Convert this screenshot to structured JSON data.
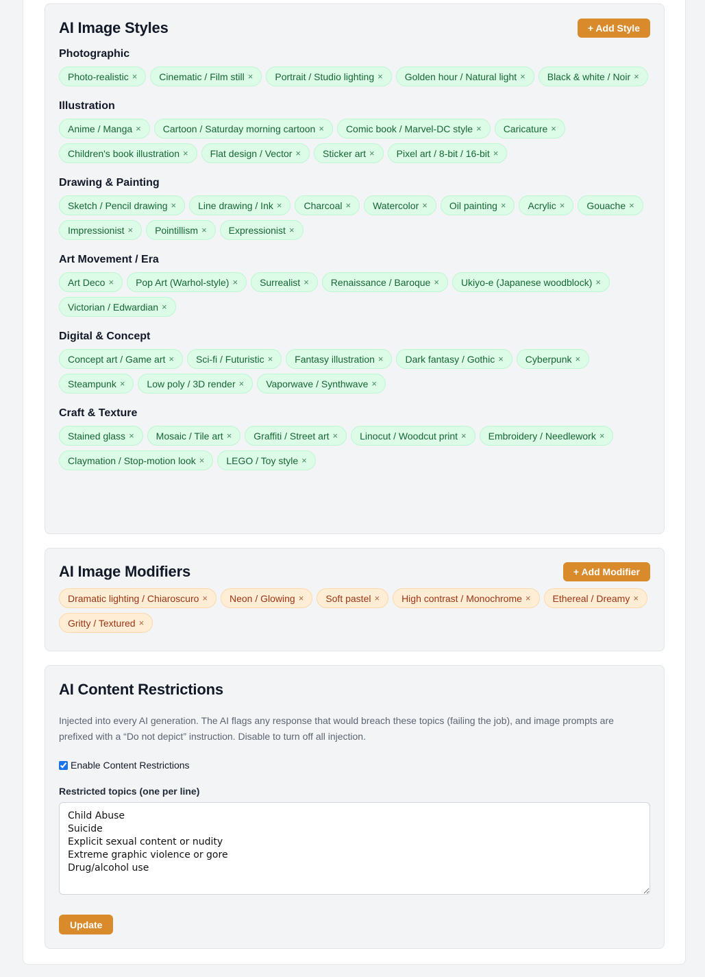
{
  "styles": {
    "title": "AI Image Styles",
    "add_label": "+ Add Style",
    "groups": [
      {
        "name": "Photographic",
        "tags": [
          "Photo-realistic",
          "Cinematic / Film still",
          "Portrait / Studio lighting",
          "Golden hour / Natural light",
          "Black & white / Noir"
        ]
      },
      {
        "name": "Illustration",
        "tags": [
          "Anime / Manga",
          "Cartoon / Saturday morning cartoon",
          "Comic book / Marvel-DC style",
          "Caricature",
          "Children's book illustration",
          "Flat design / Vector",
          "Sticker art",
          "Pixel art / 8-bit / 16-bit"
        ]
      },
      {
        "name": "Drawing & Painting",
        "tags": [
          "Sketch / Pencil drawing",
          "Line drawing / Ink",
          "Charcoal",
          "Watercolor",
          "Oil painting",
          "Acrylic",
          "Gouache",
          "Impressionist",
          "Pointillism",
          "Expressionist"
        ]
      },
      {
        "name": "Art Movement / Era",
        "tags": [
          "Art Deco",
          "Pop Art (Warhol-style)",
          "Surrealist",
          "Renaissance / Baroque",
          "Ukiyo-e (Japanese woodblock)",
          "Victorian / Edwardian"
        ]
      },
      {
        "name": "Digital & Concept",
        "tags": [
          "Concept art / Game art",
          "Sci-fi / Futuristic",
          "Fantasy illustration",
          "Dark fantasy / Gothic",
          "Cyberpunk",
          "Steampunk",
          "Low poly / 3D render",
          "Vaporwave / Synthwave"
        ]
      },
      {
        "name": "Craft & Texture",
        "tags": [
          "Stained glass",
          "Mosaic / Tile art",
          "Graffiti / Street art",
          "Linocut / Woodcut print",
          "Embroidery / Needlework",
          "Claymation / Stop-motion look",
          "LEGO / Toy style"
        ]
      }
    ]
  },
  "modifiers": {
    "title": "AI Image Modifiers",
    "add_label": "+ Add Modifier",
    "tags": [
      "Dramatic lighting / Chiaroscuro",
      "Neon / Glowing",
      "Soft pastel",
      "High contrast / Monochrome",
      "Ethereal / Dreamy",
      "Gritty / Textured"
    ]
  },
  "restrictions": {
    "title": "AI Content Restrictions",
    "description": "Injected into every AI generation. The AI flags any response that would breach these topics (failing the job), and image prompts are prefixed with a “Do not depict” instruction. Disable to turn off all injection.",
    "enable_label": "Enable Content Restrictions",
    "enabled": true,
    "topics_label": "Restricted topics (one per line)",
    "topics_value": "Child Abuse\nSuicide\nExplicit sexual content or nudity\nExtreme graphic violence or gore\nDrug/alcohol use",
    "update_label": "Update"
  },
  "remove_glyph": "×",
  "colors": {
    "accent": "#d98a2b",
    "style_tag_bg": "#dcfce7",
    "style_tag_text": "#166534",
    "modifier_tag_bg": "#ffedd5",
    "modifier_tag_text": "#9a3412"
  }
}
